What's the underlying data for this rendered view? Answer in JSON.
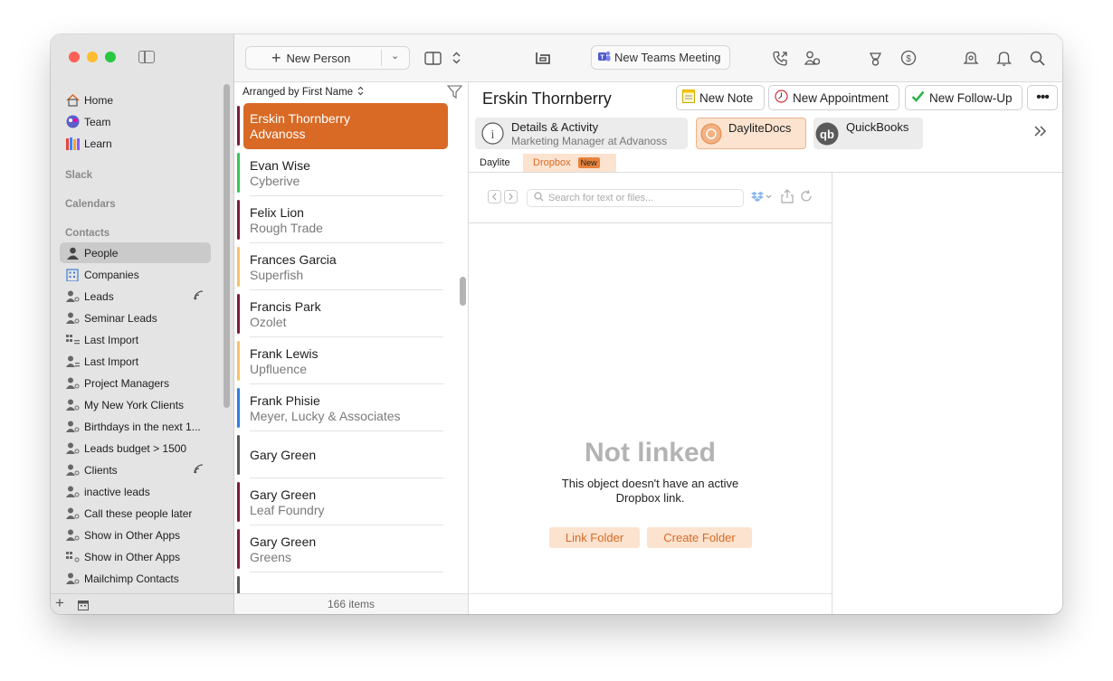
{
  "sidebar": {
    "nav": [
      {
        "label": "Home",
        "icon": "house-icon"
      },
      {
        "label": "Team",
        "icon": "team-icon"
      },
      {
        "label": "Learn",
        "icon": "books-icon"
      }
    ],
    "sections": {
      "slack": "Slack",
      "calendars": "Calendars",
      "contacts": "Contacts"
    },
    "contacts": [
      {
        "label": "People",
        "icon": "person-icon",
        "selected": true
      },
      {
        "label": "Companies",
        "icon": "building-icon"
      },
      {
        "label": "Leads",
        "icon": "smart-list-icon",
        "shared": true
      },
      {
        "label": "Seminar Leads",
        "icon": "smart-list-icon"
      },
      {
        "label": "Last Import",
        "icon": "list-icon"
      },
      {
        "label": "Last Import",
        "icon": "smart-list-icon"
      },
      {
        "label": "Project Managers",
        "icon": "smart-list-icon"
      },
      {
        "label": "My New York Clients",
        "icon": "smart-list-icon"
      },
      {
        "label": "Birthdays in the next 1...",
        "icon": "smart-list-icon"
      },
      {
        "label": "Leads budget > 1500",
        "icon": "smart-list-icon"
      },
      {
        "label": "Clients",
        "icon": "smart-list-icon",
        "shared": true
      },
      {
        "label": "inactive leads",
        "icon": "smart-list-icon"
      },
      {
        "label": "Call these people later",
        "icon": "smart-list-icon"
      },
      {
        "label": "Show in Other Apps",
        "icon": "smart-list-icon"
      },
      {
        "label": "Show in Other Apps",
        "icon": "list-icon"
      },
      {
        "label": "Mailchimp Contacts",
        "icon": "smart-list-icon"
      }
    ]
  },
  "toolbar": {
    "new_person": "New Person",
    "teams_meeting": "New Teams Meeting"
  },
  "list": {
    "header": "Arranged by First Name",
    "footer": "166 items",
    "rows": [
      {
        "name": "Erskin Thornberry",
        "company": "Advanoss",
        "color": "#d86a26",
        "selected": true
      },
      {
        "name": "Evan Wise",
        "company": "Cyberive",
        "color": "#34c759"
      },
      {
        "name": "Felix Lion",
        "company": "Rough Trade",
        "color": "#7a1d3d"
      },
      {
        "name": "Frances Garcia",
        "company": "Superfish",
        "color": "#f5c36a"
      },
      {
        "name": "Francis Park",
        "company": "Ozolet",
        "color": "#7a1d3d"
      },
      {
        "name": "Frank Lewis",
        "company": "Upfluence",
        "color": "#f5c36a"
      },
      {
        "name": "Frank Phisie",
        "company": "Meyer, Lucky & Associates",
        "color": "#2f7fe0"
      },
      {
        "name": "Gary Green",
        "company": "",
        "color": "#5a5a5a"
      },
      {
        "name": "Gary Green",
        "company": "Leaf Foundry",
        "color": "#7a1d3d"
      },
      {
        "name": "Gary Green",
        "company": "Greens",
        "color": "#7a1d3d"
      }
    ]
  },
  "detail": {
    "title": "Erskin Thornberry",
    "buttons": {
      "note": "New Note",
      "appointment": "New Appointment",
      "followup": "New Follow-Up"
    },
    "tabs": {
      "details_title": "Details & Activity",
      "details_sub": "Marketing Manager at Advanoss",
      "daylitedocs": "DayliteDocs",
      "quickbooks": "QuickBooks"
    },
    "subtabs": {
      "daylite": "Daylite",
      "dropbox": "Dropbox",
      "badge": "New"
    },
    "dropbox": {
      "search_placeholder": "Search for text or files...",
      "status": "Not linked",
      "message_line1": "This object doesn't have an active",
      "message_line2": "Dropbox link.",
      "link_folder": "Link Folder",
      "create_folder": "Create Folder"
    }
  },
  "colors": {
    "accent": "#d86a26",
    "accent_light": "#fbe3cf"
  }
}
